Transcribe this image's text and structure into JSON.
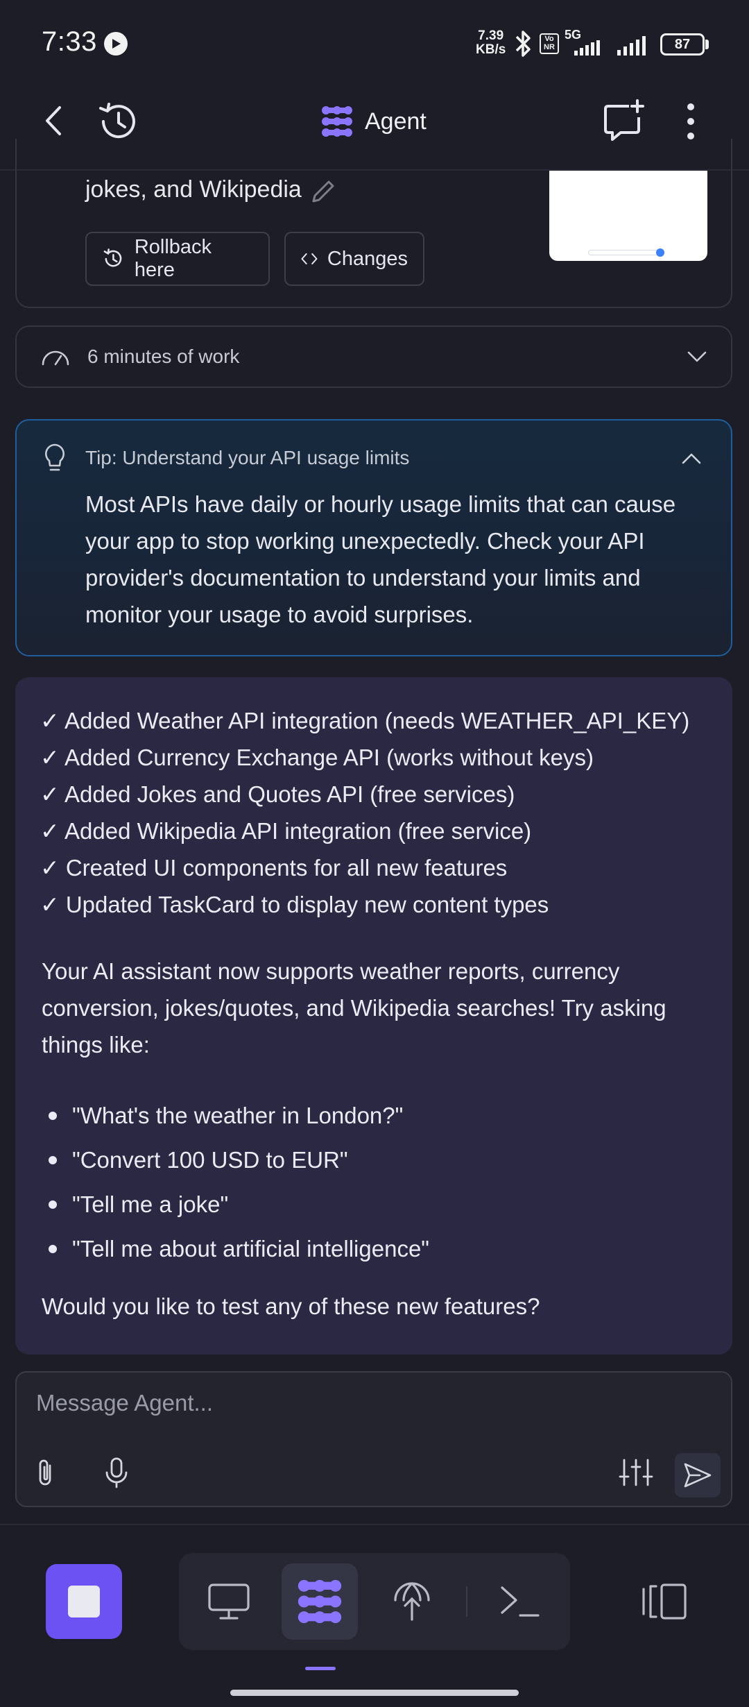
{
  "status_bar": {
    "time": "7:33",
    "net_speed_value": "7.39",
    "net_speed_unit": "KB/s",
    "network": "5G",
    "volte": "Vo NR",
    "battery": "87"
  },
  "header": {
    "title": "Agent"
  },
  "checkpoint": {
    "text": "jokes, and Wikipedia",
    "rollback_label": "Rollback here",
    "changes_label": "Changes"
  },
  "work": {
    "label": "6 minutes of work"
  },
  "tip": {
    "title": "Tip: Understand your API usage limits",
    "body": "Most APIs have daily or hourly usage limits that can cause your app to stop working unexpectedly. Check your API provider's documentation to understand your limits and monitor your usage to avoid surprises."
  },
  "message": {
    "checklist": [
      "✓ Added Weather API integration (needs WEATHER_API_KEY)",
      "✓ Added Currency Exchange API (works without keys)",
      "✓ Added Jokes and Quotes API (free services)",
      "✓ Added Wikipedia API integration (free service)",
      "✓ Created UI components for all new features",
      "✓ Updated TaskCard to display new content types"
    ],
    "summary": "Your AI assistant now supports weather reports, currency conversion, jokes/quotes, and Wikipedia searches! Try asking things like:",
    "examples": [
      "\"What's the weather in London?\"",
      "\"Convert 100 USD to EUR\"",
      "\"Tell me a joke\"",
      "\"Tell me about artificial intelligence\""
    ],
    "question": "Would you like to test any of these new features?"
  },
  "input": {
    "placeholder": "Message Agent..."
  },
  "colors": {
    "background": "#1c1d26",
    "message_bubble": "#2b2843",
    "accent": "#6c52f2",
    "tip_border": "#1f5d9c"
  }
}
